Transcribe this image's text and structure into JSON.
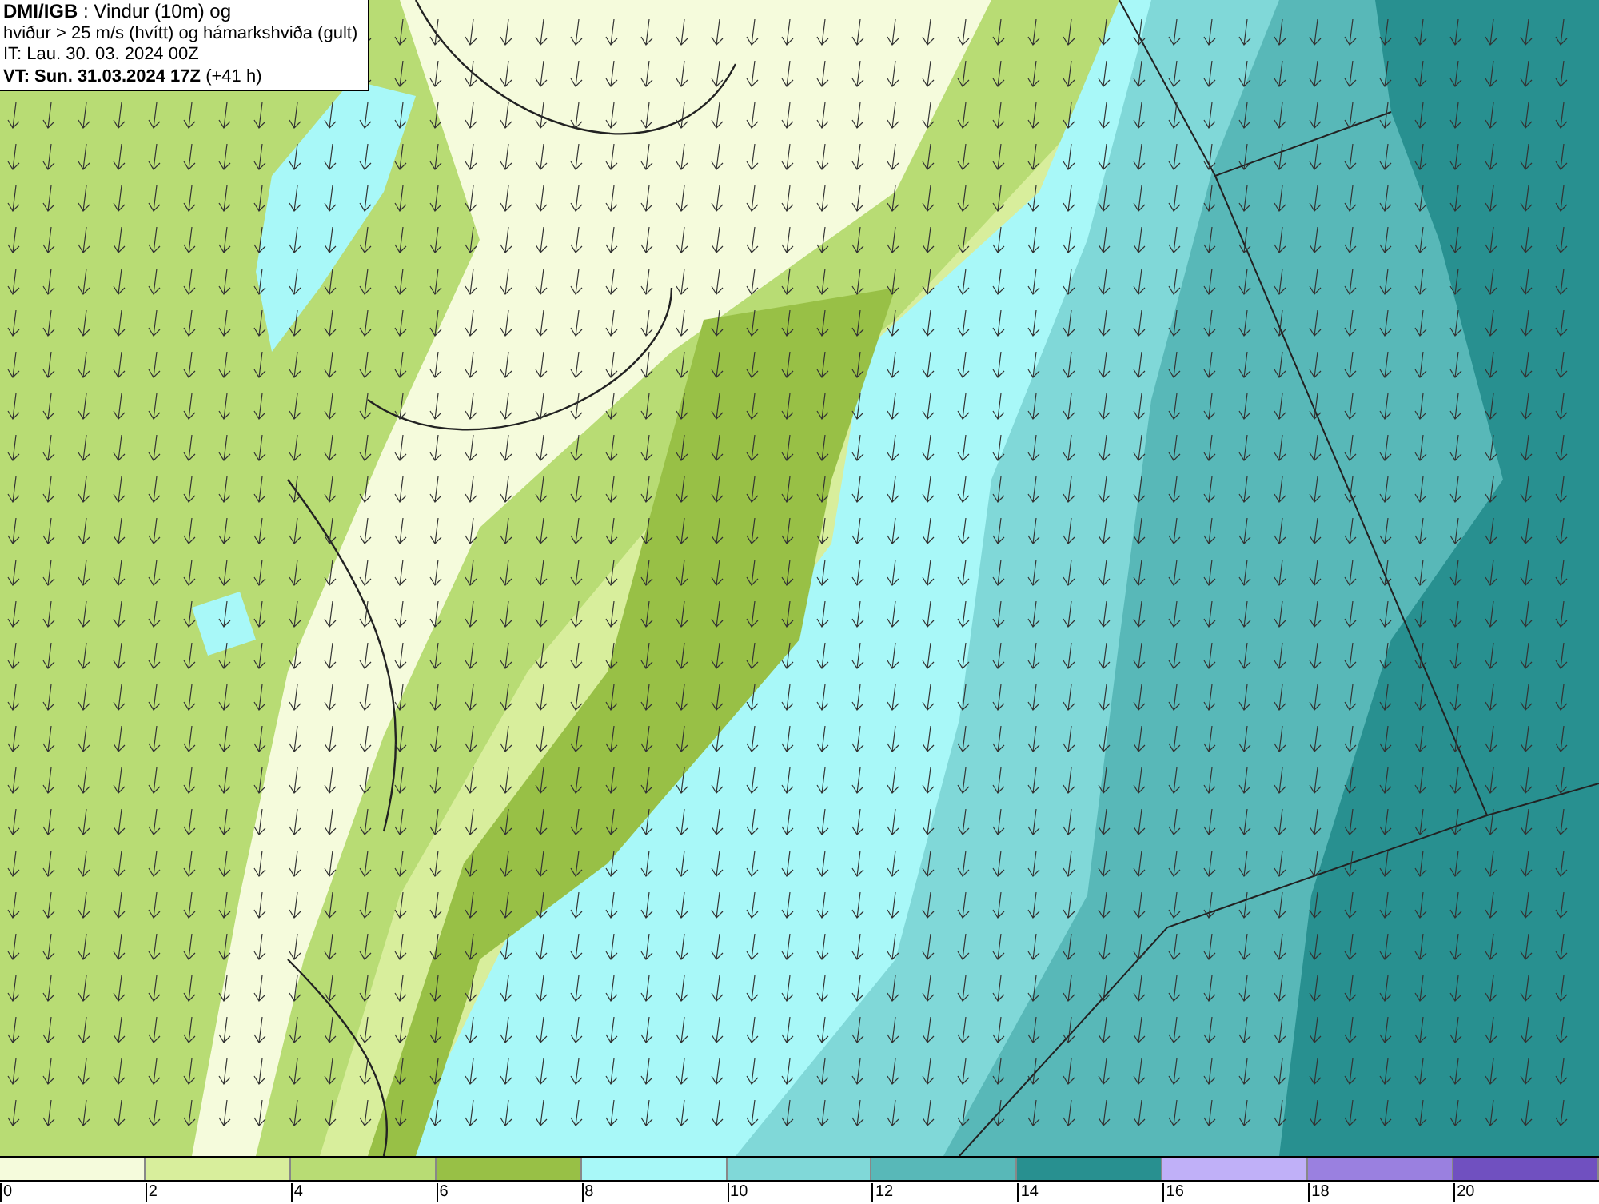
{
  "title_box": {
    "lines": [
      "**DMI/IGB** : Vindur (10m) og",
      "hviður > 25 m/s (hvítt) og hámarkshviða (gult)",
      "IT: Lau. 30. 03. 2024 00Z",
      "**VT: Sun. 31.03.2024 17Z** (+41 h)"
    ]
  },
  "legend": {
    "swatches": [
      {
        "color": "#f5fbdc"
      },
      {
        "color": "#d8ee9c"
      },
      {
        "color": "#b8dc74"
      },
      {
        "color": "#98c046"
      },
      {
        "color": "#a8f8f8"
      },
      {
        "color": "#80d8d8"
      },
      {
        "color": "#58b8b8"
      },
      {
        "color": "#289090"
      },
      {
        "color": "#c0b0f8"
      },
      {
        "color": "#9a80e0"
      },
      {
        "color": "#7050c0"
      }
    ],
    "ticks": [
      "0",
      "2",
      "4",
      "6",
      "8",
      "10",
      "12",
      "14",
      "16",
      "18",
      "20"
    ]
  }
}
